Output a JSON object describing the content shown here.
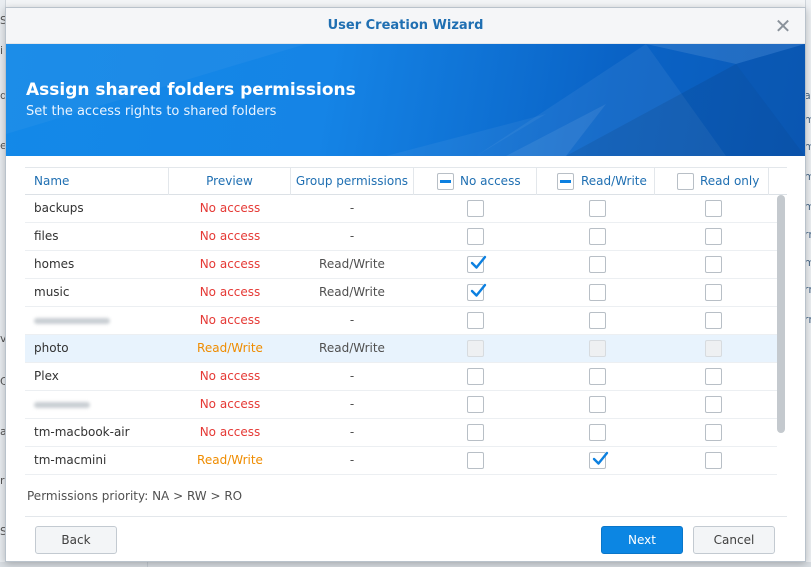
{
  "dialog": {
    "title": "User Creation Wizard",
    "close_glyph": "✕"
  },
  "banner": {
    "title": "Assign shared folders permissions",
    "subtitle": "Set the access rights to shared folders"
  },
  "table": {
    "columns": {
      "name": "Name",
      "preview": "Preview",
      "group": "Group permissions",
      "no_access": "No access",
      "read_write": "Read/Write",
      "read_only": "Read only"
    },
    "rows": [
      {
        "name": "backups",
        "preview": "No access",
        "group": "-",
        "no_access": false,
        "read_write": false,
        "read_only": false
      },
      {
        "name": "files",
        "preview": "No access",
        "group": "-",
        "no_access": false,
        "read_write": false,
        "read_only": false
      },
      {
        "name": "homes",
        "preview": "No access",
        "group": "Read/Write",
        "no_access": true,
        "read_write": false,
        "read_only": false
      },
      {
        "name": "music",
        "preview": "No access",
        "group": "Read/Write",
        "no_access": true,
        "read_write": false,
        "read_only": false
      },
      {
        "name": "",
        "preview": "No access",
        "group": "-",
        "no_access": false,
        "read_write": false,
        "read_only": false
      },
      {
        "name": "photo",
        "preview": "Read/Write",
        "group": "Read/Write",
        "no_access": false,
        "read_write": false,
        "read_only": false
      },
      {
        "name": "Plex",
        "preview": "No access",
        "group": "-",
        "no_access": false,
        "read_write": false,
        "read_only": false
      },
      {
        "name": "",
        "preview": "No access",
        "group": "-",
        "no_access": false,
        "read_write": false,
        "read_only": false
      },
      {
        "name": "tm-macbook-air",
        "preview": "No access",
        "group": "-",
        "no_access": false,
        "read_write": false,
        "read_only": false
      },
      {
        "name": "tm-macmini",
        "preview": "Read/Write",
        "group": "-",
        "no_access": false,
        "read_write": true,
        "read_only": false
      }
    ]
  },
  "priority_text": "Permissions priority: NA > RW > RO",
  "buttons": {
    "back": "Back",
    "next": "Next",
    "cancel": "Cancel"
  },
  "background_glyphs": {
    "left": [
      "S",
      "i",
      "d",
      "e",
      "",
      "",
      "v",
      "C",
      "",
      "a",
      "rk",
      "S"
    ],
    "right": [
      "at",
      "m",
      "m",
      "m",
      "m",
      "rm",
      "m",
      "rm",
      "rm",
      "rm"
    ]
  },
  "colors": {
    "accent": "#1f6fb2",
    "primary_button": "#0c86e3",
    "no_access": "#e53935",
    "read_write": "#ef8c00"
  }
}
